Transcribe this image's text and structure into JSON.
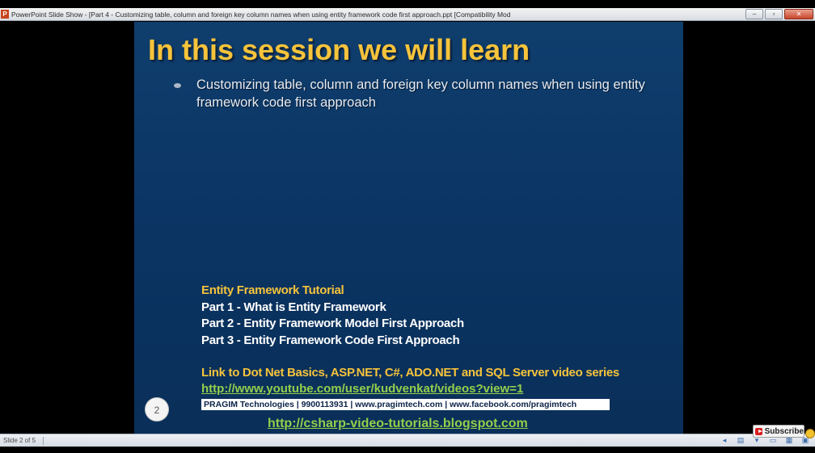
{
  "window": {
    "app_icon": "P",
    "title": "PowerPoint Slide Show - [Part 4 - Customizing table, column and foreign key column names when using entity framework code first approach.ppt [Compatibility Mod",
    "buttons": {
      "minimize": "–",
      "restore": "▫",
      "close": "✕"
    }
  },
  "slide": {
    "title": "In this session we will learn",
    "bullet": "Customizing table, column and foreign key column names when using entity framework code first approach",
    "tutorial_heading": "Entity Framework Tutorial",
    "parts": [
      "Part 1 - What is Entity Framework",
      "Part 2 - Entity Framework Model First Approach",
      "Part 3 - Entity Framework Code First Approach"
    ],
    "link_heading": "Link to Dot Net Basics, ASP.NET, C#, ADO.NET and SQL Server video series",
    "youtube_link": "http://www.youtube.com/user/kudvenkat/videos?view=1",
    "pragim_bar": "PRAGIM Technologies | 9900113931 | www.pragimtech.com | www.facebook.com/pragimtech",
    "blog_link": "http://csharp-video-tutorials.blogspot.com",
    "slide_number": "2",
    "colors": {
      "title": "#f6c33b",
      "link": "#93cf4b",
      "background": "#0b3564"
    }
  },
  "status": {
    "slide_indicator": "Slide 2 of 5",
    "icons": [
      "arrow-left-icon",
      "notes-icon",
      "arrow-down-icon",
      "normal-view-icon",
      "slide-sorter-icon",
      "reading-view-icon"
    ]
  },
  "overlay": {
    "subscribe": "Subscribe",
    "icon": "youtube-icon"
  }
}
